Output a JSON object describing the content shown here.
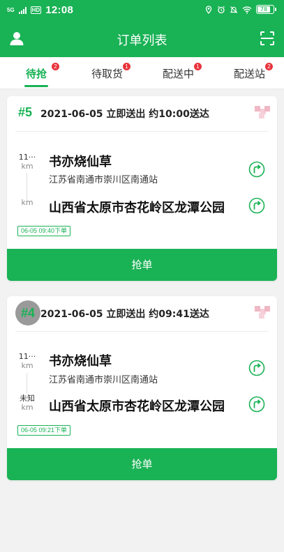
{
  "status_bar": {
    "signal_label": "5G",
    "hd_label": "HD",
    "time": "12:08",
    "battery": "78"
  },
  "header": {
    "title": "订单列表"
  },
  "tabs": [
    {
      "label": "待抢",
      "badge": "2",
      "active": true
    },
    {
      "label": "待取货",
      "badge": "1",
      "active": false
    },
    {
      "label": "配送中",
      "badge": "1",
      "active": false
    },
    {
      "label": "配送站",
      "badge": "2",
      "active": false
    }
  ],
  "orders": [
    {
      "number": "#5",
      "time_info": "2021-06-05 立即送出 约10:00送达",
      "pickup": {
        "distance": "11···",
        "unit": "km",
        "name": "书亦烧仙草",
        "address": "江苏省南通市崇川区南通站"
      },
      "dropoff": {
        "distance": "",
        "unit": "km",
        "name": "山西省太原市杏花岭区龙潭公园"
      },
      "ordered_at": "06-05 09:40下单",
      "grab_label": "抢单"
    },
    {
      "number": "#4",
      "time_info": "2021-06-05 立即送出 约09:41送达",
      "pickup": {
        "distance": "11···",
        "unit": "km",
        "name": "书亦烧仙草",
        "address": "江苏省南通市崇川区南通站"
      },
      "dropoff": {
        "distance": "未知",
        "unit": "km",
        "name": "山西省太原市杏花岭区龙潭公园"
      },
      "ordered_at": "06-05 09:21下单",
      "grab_label": "抢单"
    }
  ],
  "colors": {
    "brand_green": "#19b255",
    "badge_red": "#e8333b"
  },
  "icons": {
    "user": "user-icon",
    "scan": "scan-icon",
    "navigate": "navigate-icon"
  }
}
